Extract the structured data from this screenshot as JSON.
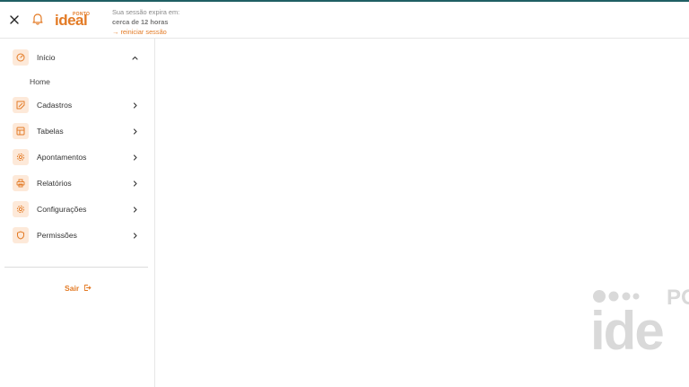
{
  "header": {
    "logo_small": "PONTO",
    "logo_main": "ideal",
    "session_line1": "Sua sessão expira em:",
    "session_line2": "cerca de 12 horas",
    "session_line3": "→ reiniciar sessão"
  },
  "sidebar": {
    "items": [
      {
        "label": "Início",
        "icon": "dashboard-icon",
        "expanded": true
      },
      {
        "label": "Cadastros",
        "icon": "edit-icon"
      },
      {
        "label": "Tabelas",
        "icon": "table-icon"
      },
      {
        "label": "Apontamentos",
        "icon": "gear-icon"
      },
      {
        "label": "Relatórios",
        "icon": "printer-icon"
      },
      {
        "label": "Configurações",
        "icon": "gear-icon"
      },
      {
        "label": "Permissões",
        "icon": "shield-icon"
      }
    ],
    "sub_items": [
      {
        "label": "Home"
      }
    ],
    "logout_label": "Sair"
  },
  "watermark": {
    "text_small": "PO",
    "text_main": "ide"
  },
  "colors": {
    "accent": "#e37b26",
    "accent_light": "#fde9d9",
    "top_bar": "#1f5f63",
    "watermark": "#d9d9d9"
  }
}
